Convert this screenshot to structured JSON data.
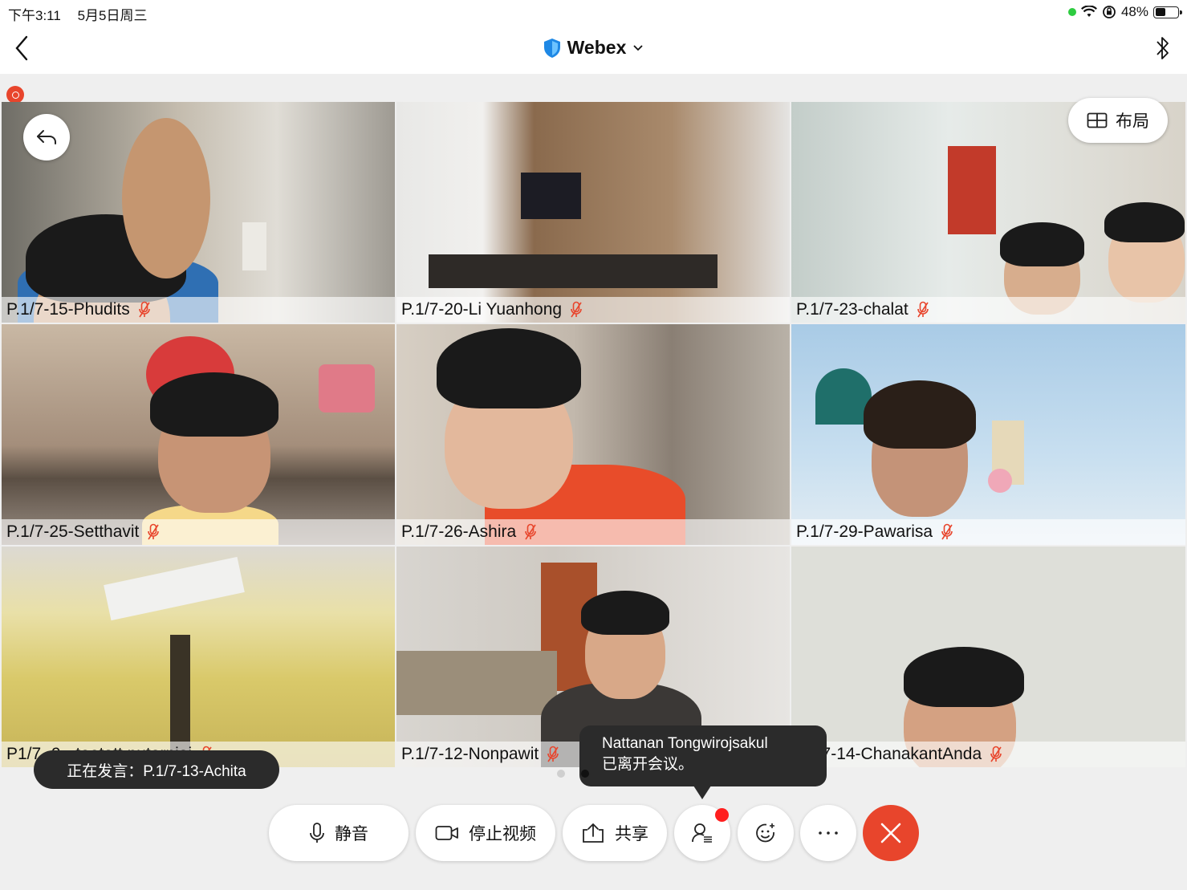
{
  "status_bar": {
    "time": "下午3:11",
    "date": "5月5日周三",
    "battery": "48%",
    "battery_level": 0.48
  },
  "nav": {
    "title": "Webex"
  },
  "layout_button": {
    "label": "布局"
  },
  "participants": [
    {
      "name": "P.1/7-15-Phudits",
      "bg": "#c9c2b6"
    },
    {
      "name": "P.1/7-20-Li Yuanhong",
      "bg": "#8a7460"
    },
    {
      "name": "P.1/7-23-chalat",
      "bg": "#d9dedb"
    },
    {
      "name": "P.1/7-25-Setthavit",
      "bg": "#a6998e"
    },
    {
      "name": "P.1/7-26-Ashira",
      "bg": "#b5aba0"
    },
    {
      "name": "P.1/7-29-Pawarisa",
      "bg": "#b8d4ea"
    },
    {
      "name": "P1/7 -9 - teetatt putornjai",
      "bg": "#e7dc8a"
    },
    {
      "name": "P.1/7-12-Nonpawit",
      "bg": "#d6d3cf"
    },
    {
      "name": "P1/7-14-ChanakantAnda",
      "bg": "#dedfd9"
    }
  ],
  "speaking": "正在发言：P.1/7-13-Achita",
  "toast": {
    "name": "Nattanan Tongwirojsakul",
    "message": "已离开会议。"
  },
  "controls": {
    "mute": "静音",
    "stop_video": "停止视频",
    "share": "共享"
  },
  "colors": {
    "end_call": "#e8452c",
    "muted_mic": "#e8452c",
    "badge": "#ff1f1f"
  }
}
